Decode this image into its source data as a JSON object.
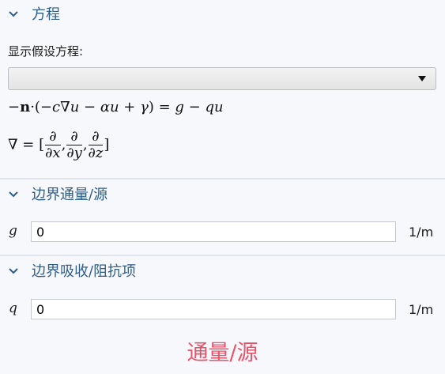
{
  "equation_section": {
    "title": "方程",
    "show_label": "显示假设方程:",
    "dropdown_value": "",
    "eq_neg_n": "−",
    "eq_n": "n",
    "eq_mid": "·(−",
    "eq_c": "c",
    "eq_nabla_u": "∇",
    "eq_u1": "u",
    "eq_minus_alpha": " − ",
    "eq_alpha": "α",
    "eq_u2": "u",
    "eq_plus": " + ",
    "eq_gamma": "γ",
    "eq_close": ") = ",
    "eq_g": "g",
    "eq_minus": " − ",
    "eq_q": "q",
    "eq_u3": "u",
    "nabla_def": "∇ = [",
    "partial": "∂",
    "dx": "∂x",
    "dy": "∂y",
    "dz": "∂z",
    "comma": ",",
    "bracket_close": "]"
  },
  "boundary_flux_section": {
    "title": "边界通量/源",
    "symbol": "g",
    "value": "0",
    "unit": "1/m"
  },
  "boundary_absorption_section": {
    "title": "边界吸收/阻抗项",
    "symbol": "q",
    "value": "0",
    "unit": "1/m"
  },
  "overlay_label": "通量/源",
  "colors": {
    "section_title": "#2f5d8a",
    "overlay_label": "#e8536a",
    "background": "#f7f8fb"
  }
}
